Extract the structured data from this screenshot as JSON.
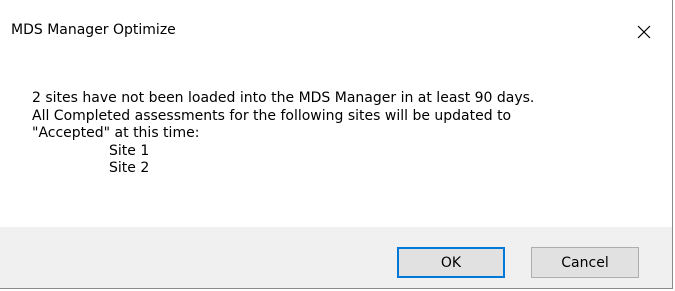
{
  "window": {
    "title": "MDS Manager Optimize"
  },
  "message": {
    "lines": [
      "2 sites have not been loaded into the MDS Manager in at least 90 days.",
      "All Completed assessments for the following sites will be updated to",
      "\"Accepted\" at this time:"
    ],
    "sites": [
      "Site 1",
      "Site 2"
    ]
  },
  "buttons": {
    "ok_label": "OK",
    "cancel_label": "Cancel"
  },
  "icons": {
    "close": "close-icon"
  },
  "colors": {
    "focus_border": "#0078d7",
    "footer_background": "#f0f0f0",
    "button_background": "#e1e1e1"
  }
}
